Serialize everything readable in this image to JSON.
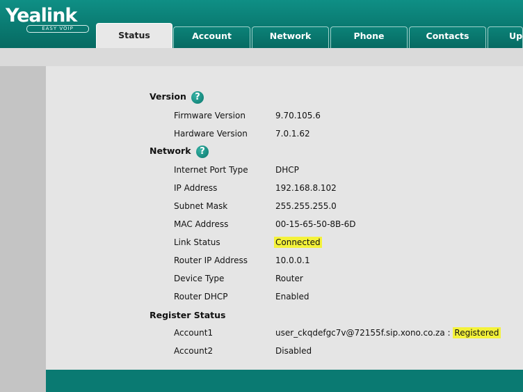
{
  "logo": {
    "brand": "Yealink",
    "tagline": "EASY VOIP"
  },
  "tabs": [
    {
      "label": "Status"
    },
    {
      "label": "Account"
    },
    {
      "label": "Network"
    },
    {
      "label": "Phone"
    },
    {
      "label": "Contacts"
    },
    {
      "label": "Upg"
    }
  ],
  "sections": {
    "version": {
      "title": "Version",
      "help": "?",
      "rows": [
        {
          "label": "Firmware Version",
          "value": "9.70.105.6"
        },
        {
          "label": "Hardware Version",
          "value": "7.0.1.62"
        }
      ]
    },
    "network": {
      "title": "Network",
      "help": "?",
      "rows": [
        {
          "label": "Internet Port Type",
          "value": "DHCP"
        },
        {
          "label": "IP Address",
          "value": "192.168.8.102"
        },
        {
          "label": "Subnet Mask",
          "value": "255.255.255.0"
        },
        {
          "label": "MAC Address",
          "value": "00-15-65-50-8B-6D"
        },
        {
          "label": "Link Status",
          "value": "Connected"
        },
        {
          "label": "Router IP Address",
          "value": "10.0.0.1"
        },
        {
          "label": "Device Type",
          "value": "Router"
        },
        {
          "label": "Router DHCP",
          "value": "Enabled"
        }
      ]
    },
    "register": {
      "title": "Register Status",
      "rows": [
        {
          "label": "Account1",
          "value": "user_ckqdefgc7v@72155f.sip.xono.co.za",
          "separator": ":",
          "status": "Registered"
        },
        {
          "label": "Account2",
          "value": "Disabled"
        }
      ]
    }
  },
  "colors": {
    "header": "#0a7a71",
    "highlight": "#f4f23a",
    "background": "#e5e5e5"
  }
}
